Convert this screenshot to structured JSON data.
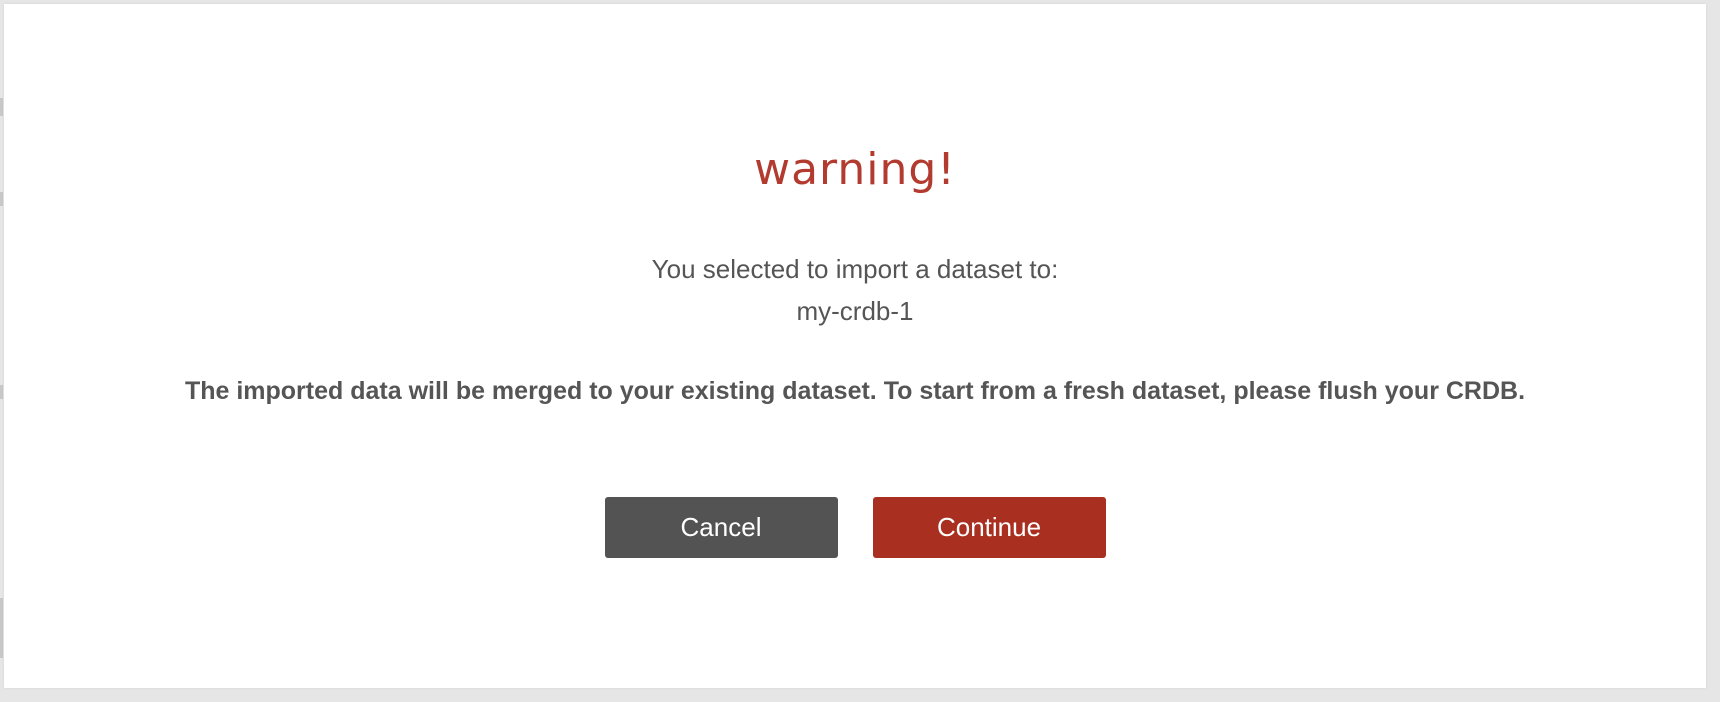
{
  "dialog": {
    "title": "warning!",
    "message_line1": "You selected to import a dataset to:",
    "target_database": "my-crdb-1",
    "notice": "The imported data will be merged to your existing dataset. To start from a fresh dataset, please flush your CRDB.",
    "cancel_label": "Cancel",
    "continue_label": "Continue"
  },
  "colors": {
    "title": "#b23a2e",
    "text": "#555555",
    "cancel_button": "#535353",
    "continue_button": "#a93020",
    "backdrop": "#e6e6e6"
  }
}
